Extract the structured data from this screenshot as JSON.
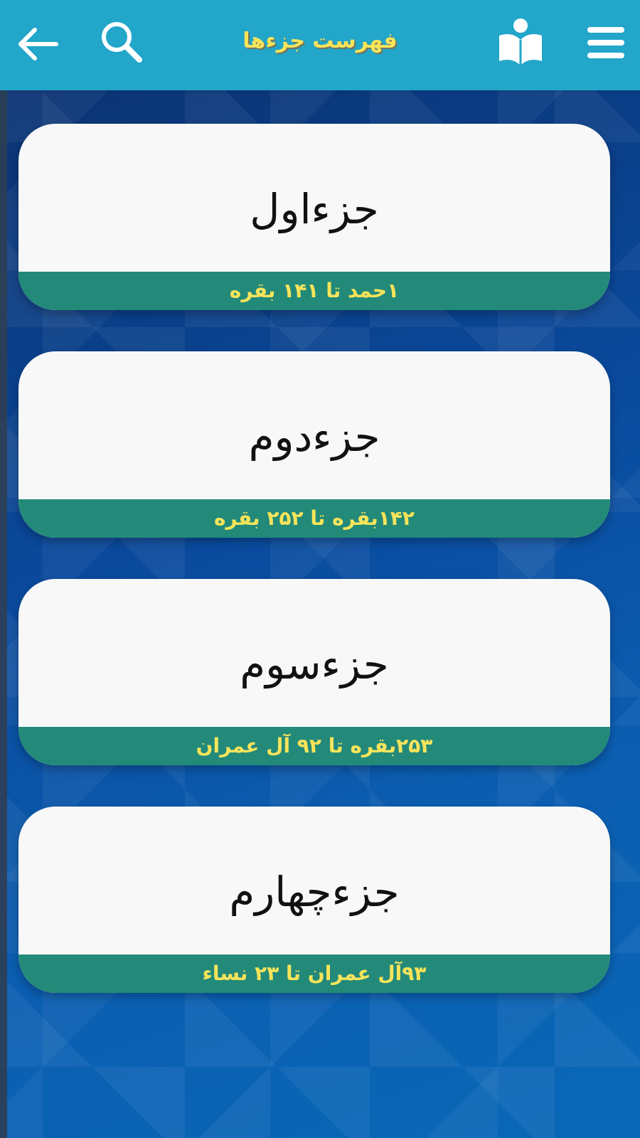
{
  "appbar": {
    "title": "فهرست جزءها",
    "background_color": "#22a6c9",
    "title_color": "#f7e45a",
    "icons": {
      "back": "arrow-left-icon",
      "search": "search-icon",
      "book": "book-reader-icon",
      "menu": "hamburger-menu-icon"
    }
  },
  "juz_list": [
    {
      "name": "جزءاول",
      "range": "۱حمد تا ۱۴۱ بقره"
    },
    {
      "name": "جزءدوم",
      "range": "۱۴۲بقره تا ۲۵۲ بقره"
    },
    {
      "name": "جزءسوم",
      "range": "۲۵۳بقره تا ۹۲ آل عمران"
    },
    {
      "name": "جزءچهارم",
      "range": "۹۳آل عمران تا ۲۳ نساء"
    }
  ],
  "colors": {
    "card_background": "#f8f8f8",
    "range_bar": "#238a7a",
    "range_text": "#f7e45a",
    "page_background": "#0a4a9d"
  }
}
